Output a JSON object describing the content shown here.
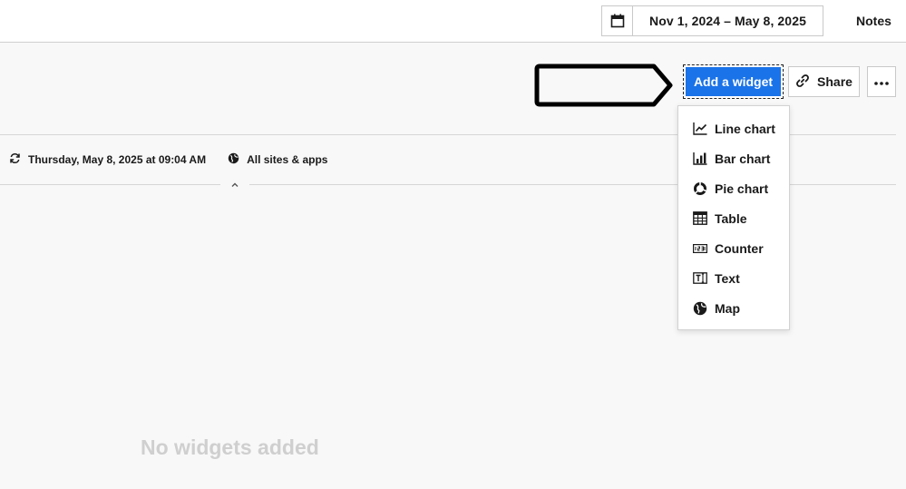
{
  "header": {
    "date_range": "Nov 1, 2024 – May 8, 2025",
    "notes_label": "Notes"
  },
  "toolbar": {
    "add_widget_label": "Add a widget",
    "share_label": "Share"
  },
  "info": {
    "refreshed": "Thursday, May 8, 2025 at 09:04 AM",
    "scope": "All sites & apps"
  },
  "widget_menu": {
    "items": [
      {
        "label": "Line chart",
        "icon": "line-chart-icon"
      },
      {
        "label": "Bar chart",
        "icon": "bar-chart-icon"
      },
      {
        "label": "Pie chart",
        "icon": "pie-chart-icon"
      },
      {
        "label": "Table",
        "icon": "table-icon"
      },
      {
        "label": "Counter",
        "icon": "counter-icon"
      },
      {
        "label": "Text",
        "icon": "text-icon"
      },
      {
        "label": "Map",
        "icon": "globe-icon"
      }
    ]
  },
  "empty_state": "No widgets added",
  "colors": {
    "accent": "#1a73e8",
    "background": "#f8f8f8",
    "empty_text": "#cfcfcf"
  }
}
